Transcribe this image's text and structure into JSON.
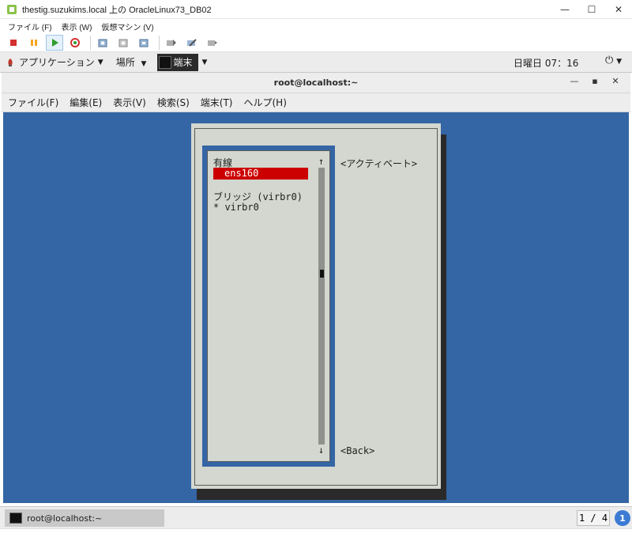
{
  "host": {
    "title": "thestig.suzukims.local 上の OracleLinux73_DB02",
    "menu": [
      "ファイル (F)",
      "表示 (W)",
      "仮想マシン (V)"
    ],
    "controls": {
      "minimize": "—",
      "maximize": "☐",
      "close": "✕"
    }
  },
  "gnome": {
    "applications": "アプリケーション",
    "places": "場所",
    "terminal_task": "端末",
    "clock": "日曜日 07：16",
    "power": "⏻"
  },
  "terminal": {
    "title": "root@localhost:~",
    "menu": [
      "ファイル(F)",
      "編集(E)",
      "表示(V)",
      "検索(S)",
      "端末(T)",
      "ヘルプ(H)"
    ]
  },
  "nmtui": {
    "group_wired": "有線",
    "selected_item": "ens160",
    "group_bridge": "ブリッジ (virbr0)",
    "bridge_item": "* virbr0",
    "activate_button": "<アクティベート>",
    "back_button": "<Back>",
    "scroll_up": "↑",
    "scroll_down": "↓"
  },
  "taskbar": {
    "item": "root@localhost:~",
    "workspace": "1 / 4",
    "badge": "1"
  },
  "colors": {
    "terminal_bg": "#3465a4",
    "dialog_bg": "#d3d7cf",
    "selection": "#cc0000"
  }
}
